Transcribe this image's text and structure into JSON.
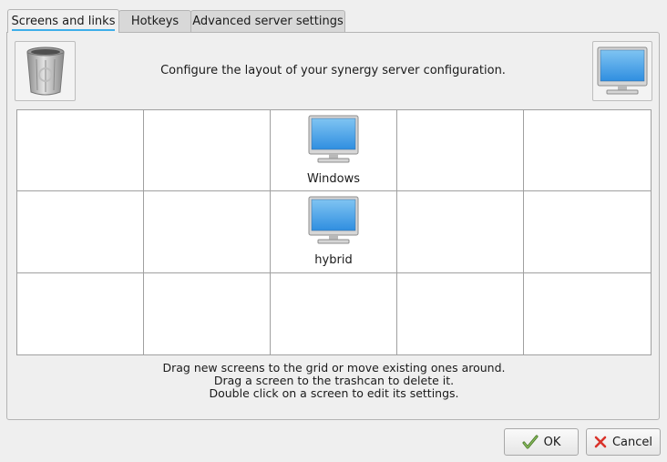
{
  "tabs": [
    {
      "label": "Screens and links",
      "active": true
    },
    {
      "label": "Hotkeys",
      "active": false
    },
    {
      "label": "Advanced server settings",
      "active": false
    }
  ],
  "header": {
    "text": "Configure the layout of your synergy server configuration."
  },
  "icons": {
    "trash": "trash-can-icon",
    "new_screen": "monitor-icon"
  },
  "grid": {
    "rows": 3,
    "columns": 5,
    "screens": [
      {
        "name": "Windows",
        "row": 1,
        "column": 3
      },
      {
        "name": "hybrid",
        "row": 2,
        "column": 3
      }
    ]
  },
  "instructions": [
    "Drag new screens to the grid or move existing ones around.",
    "Drag a screen to the trashcan to delete it.",
    "Double click on a screen to edit its settings."
  ],
  "buttons": {
    "ok": "OK",
    "cancel": "Cancel"
  },
  "colors": {
    "accent": "#3daee9",
    "monitor_screen": "#2f95e0",
    "cancel_x": "#d9332b",
    "ok_check": "#4a7a2a"
  }
}
